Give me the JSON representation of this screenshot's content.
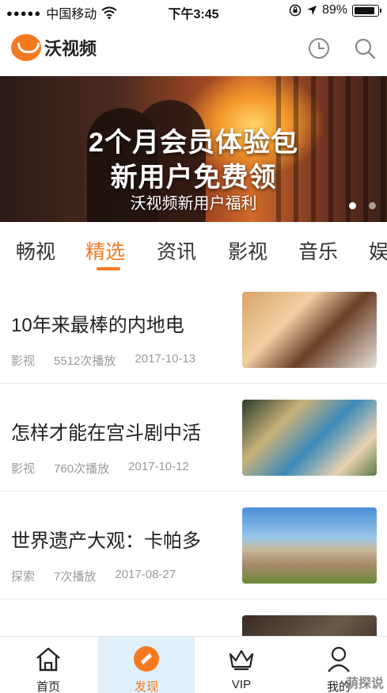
{
  "status_bar": {
    "signal_dots": "●●●●●",
    "carrier": "中国移动",
    "time": "下午3:45",
    "battery": "89%",
    "battery_level": 0.89
  },
  "header": {
    "logo_text": "沃视频",
    "icons": [
      "clock-icon",
      "search-icon"
    ]
  },
  "banner": {
    "title_line1": "2个月会员体验包",
    "title_line2": "新用户免费领",
    "subtitle": "沃视频新用户福利",
    "page_count": 2,
    "active_page": 1
  },
  "tabs": [
    {
      "label": "畅视"
    },
    {
      "label": "精选"
    },
    {
      "label": "资讯"
    },
    {
      "label": "影视"
    },
    {
      "label": "音乐"
    },
    {
      "label": "娱"
    }
  ],
  "active_tab": "精选",
  "list": [
    {
      "title": "10年来最棒的内地电",
      "category": "影视",
      "plays": "5512次播放",
      "date": "2017-10-13"
    },
    {
      "title": "怎样才能在宫斗剧中活",
      "category": "影视",
      "plays": "760次播放",
      "date": "2017-10-12"
    },
    {
      "title": "世界遗产大观：卡帕多",
      "category": "探索",
      "plays": "7次播放",
      "date": "2017-08-27"
    }
  ],
  "bottom_nav": [
    {
      "label": "首页",
      "icon": "home-icon"
    },
    {
      "label": "发现",
      "icon": "discover-icon"
    },
    {
      "label": "VIP",
      "icon": "crown-icon"
    },
    {
      "label": "我的",
      "icon": "profile-icon"
    }
  ],
  "watermark": "萌探说",
  "colors": {
    "accent": "#f47a20",
    "text": "#222222",
    "meta": "#9a9a9a"
  }
}
